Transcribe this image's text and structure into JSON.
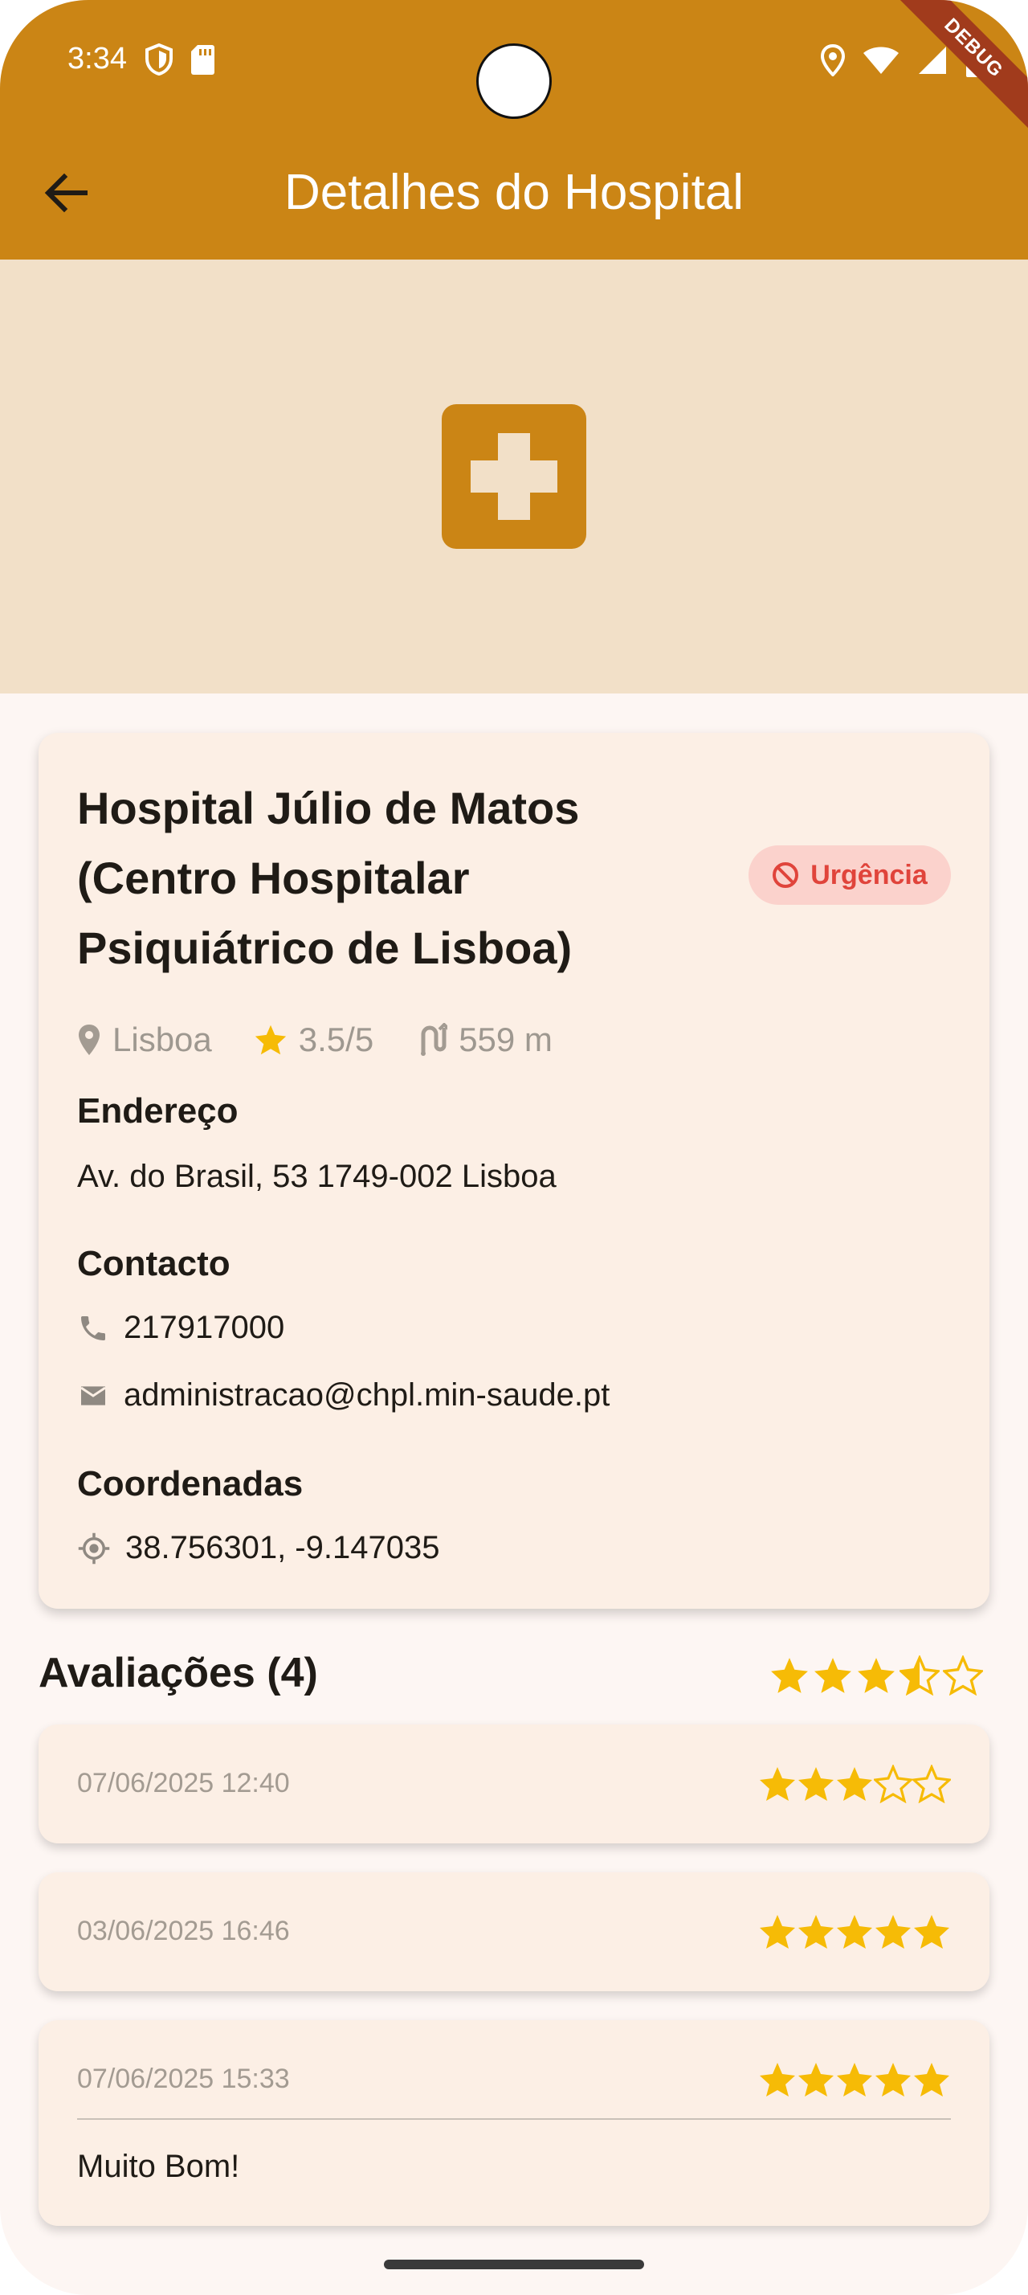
{
  "status_bar": {
    "time": "3:34",
    "left_icons": [
      "shield-icon",
      "sd-card-icon"
    ],
    "right_icons": [
      "location-icon",
      "wifi-icon",
      "signal-icon",
      "battery-icon"
    ],
    "debug_label": "DEBUG"
  },
  "appbar": {
    "title": "Detalhes do Hospital",
    "back_icon": "arrow-back-icon"
  },
  "hero": {
    "icon": "medical-cross-icon"
  },
  "colors": {
    "primary": "#cb8515",
    "hero_bg": "#f2e0c8",
    "card_bg": "#fcefe5",
    "star": "#f6bb06",
    "urgency_text": "#e0443b",
    "urgency_bg": "#fbd2cc"
  },
  "hospital": {
    "name": "Hospital Júlio de Matos (Centro Hospitalar Psiquiátrico de Lisboa)",
    "urgency_label": "Urgência",
    "meta": {
      "city": "Lisboa",
      "rating": "3.5/5",
      "distance": "559 m"
    },
    "address_title": "Endereço",
    "address": "Av. do Brasil, 53 1749-002 Lisboa",
    "contact_title": "Contacto",
    "phone": "217917000",
    "email": "administracao@chpl.min-saude.pt",
    "coords_title": "Coordenadas",
    "coords": "38.756301, -9.147035"
  },
  "reviews": {
    "header": "Avaliações (4)",
    "average_rating": 3.5,
    "items": [
      {
        "date": "07/06/2025 12:40",
        "rating": 3,
        "comment": ""
      },
      {
        "date": "03/06/2025 16:46",
        "rating": 5,
        "comment": ""
      },
      {
        "date": "07/06/2025 15:33",
        "rating": 5,
        "comment": "Muito Bom!"
      }
    ]
  }
}
